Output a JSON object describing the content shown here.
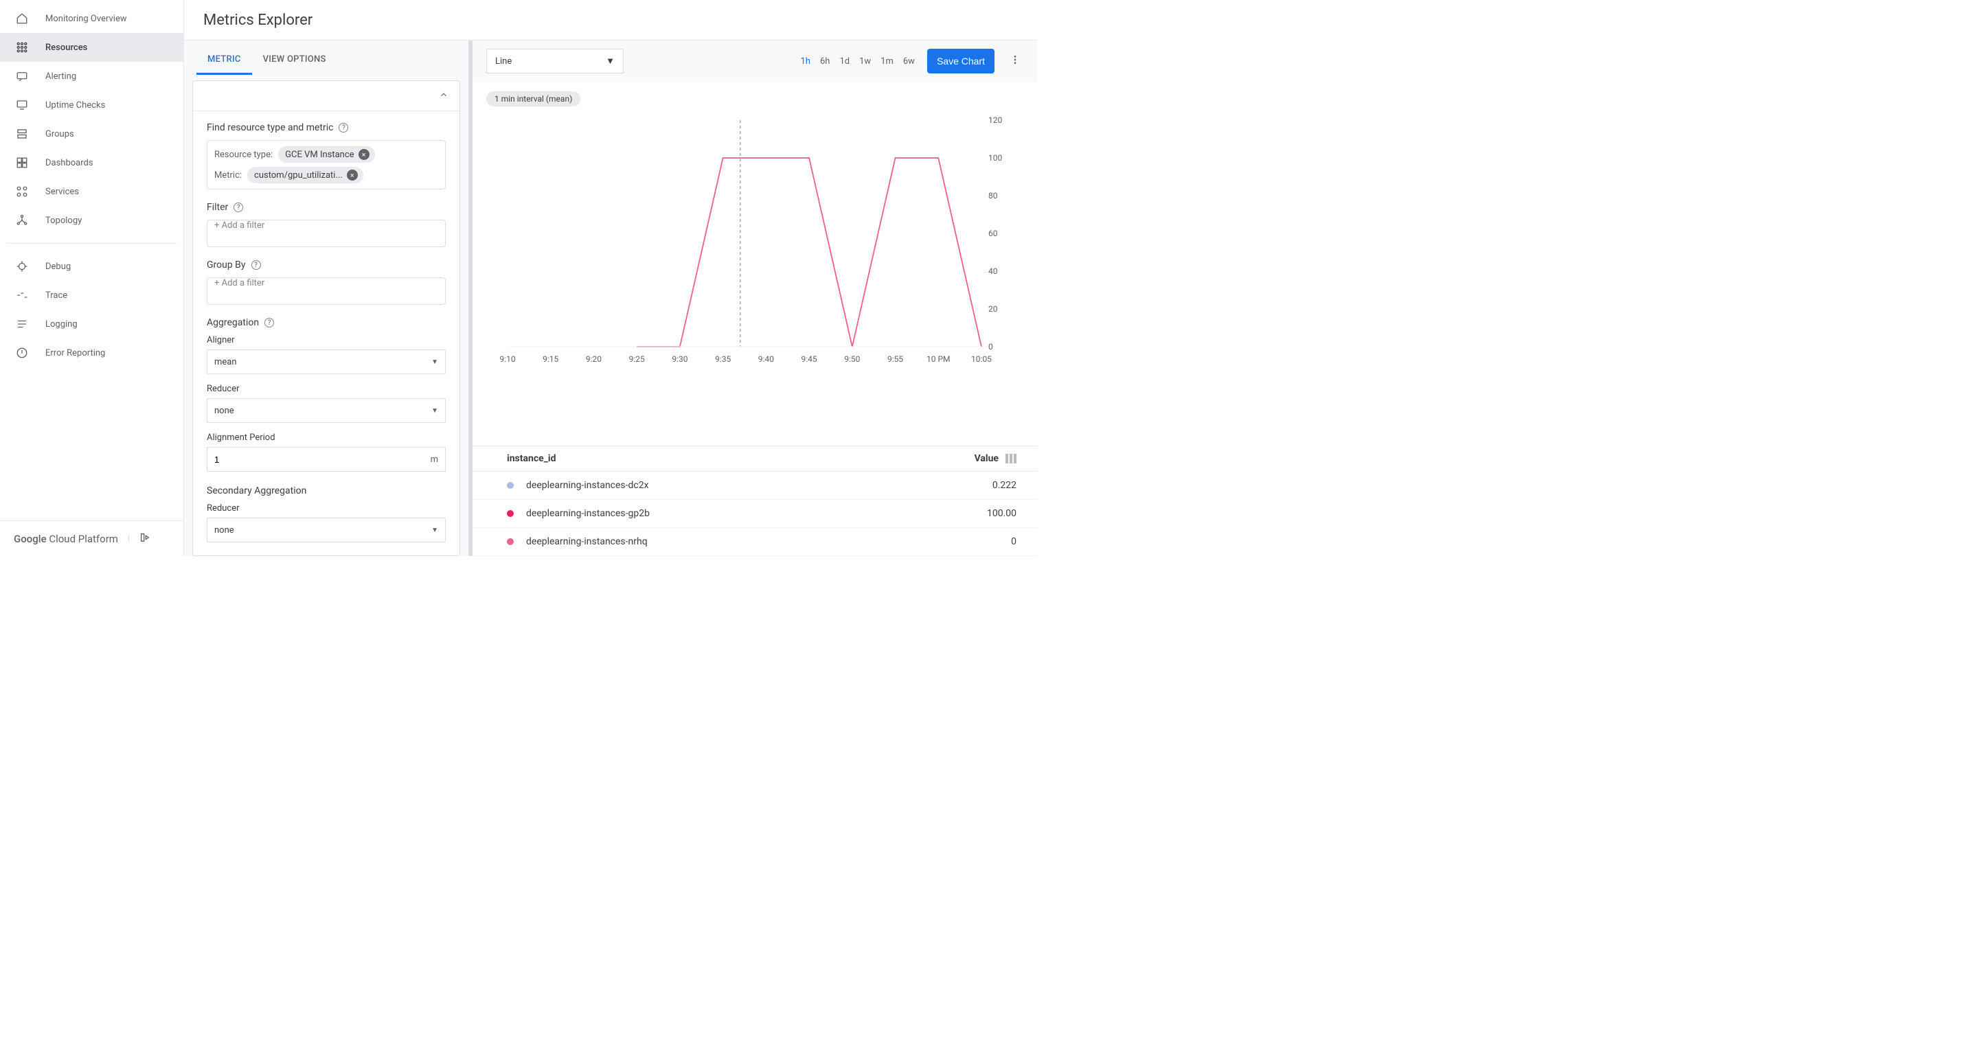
{
  "page_title": "Metrics Explorer",
  "sidebar": {
    "items": [
      {
        "label": "Monitoring Overview",
        "icon": "home",
        "active": false
      },
      {
        "label": "Resources",
        "icon": "grid",
        "active": true
      },
      {
        "label": "Alerting",
        "icon": "chat",
        "active": false
      },
      {
        "label": "Uptime Checks",
        "icon": "monitor",
        "active": false
      },
      {
        "label": "Groups",
        "icon": "stack",
        "active": false
      },
      {
        "label": "Dashboards",
        "icon": "dashboard",
        "active": false
      },
      {
        "label": "Services",
        "icon": "services",
        "active": false
      },
      {
        "label": "Topology",
        "icon": "topology",
        "active": false
      }
    ],
    "items_secondary": [
      {
        "label": "Debug",
        "icon": "debug"
      },
      {
        "label": "Trace",
        "icon": "trace"
      },
      {
        "label": "Logging",
        "icon": "logging"
      },
      {
        "label": "Error Reporting",
        "icon": "error"
      }
    ],
    "footer": "Google Cloud Platform"
  },
  "tabs": {
    "metric": "METRIC",
    "view_options": "VIEW OPTIONS"
  },
  "config": {
    "find_label": "Find resource type and metric",
    "resource_type_label": "Resource type:",
    "resource_type_value": "GCE VM Instance",
    "metric_label": "Metric:",
    "metric_value": "custom/gpu_utilizati...",
    "filter_label": "Filter",
    "filter_placeholder": "+ Add a filter",
    "groupby_label": "Group By",
    "groupby_placeholder": "+ Add a filter",
    "aggregation_label": "Aggregation",
    "aligner_label": "Aligner",
    "aligner_value": "mean",
    "reducer_label": "Reducer",
    "reducer_value": "none",
    "alignment_period_label": "Alignment Period",
    "alignment_period_value": "1",
    "alignment_period_unit": "m",
    "secondary_agg_label": "Secondary Aggregation",
    "secondary_reducer_label": "Reducer",
    "secondary_reducer_value": "none"
  },
  "chart_toolbar": {
    "chart_type": "Line",
    "ranges": [
      "1h",
      "6h",
      "1d",
      "1w",
      "1m",
      "6w"
    ],
    "active_range": "1h",
    "save_label": "Save Chart"
  },
  "interval_pill": "1 min interval (mean)",
  "chart_data": {
    "type": "line",
    "ylim": [
      0,
      100
    ],
    "yticks": [
      0,
      20,
      40,
      60,
      80,
      100,
      120
    ],
    "xticks": [
      "9:10",
      "9:15",
      "9:20",
      "9:25",
      "9:30",
      "9:35",
      "9:40",
      "9:45",
      "9:50",
      "9:55",
      "10 PM",
      "10:05"
    ],
    "cursor_x": "9:37",
    "series": [
      {
        "name": "deeplearning-instances-dc2x",
        "color": "#b0b9e8",
        "values": [
          null,
          null,
          null,
          null,
          null,
          null,
          null,
          null,
          null,
          0.2,
          null,
          null
        ]
      },
      {
        "name": "deeplearning-instances-gp2b",
        "color": "#e91e63",
        "values": [
          null,
          null,
          null,
          0,
          0,
          100,
          100,
          100,
          0,
          100,
          100,
          0
        ]
      },
      {
        "name": "deeplearning-instances-nrhq",
        "color": "#f06292",
        "values": [
          null,
          null,
          null,
          0,
          0,
          100,
          100,
          100,
          0,
          100,
          100,
          0
        ]
      }
    ]
  },
  "legend_table": {
    "col_instance": "instance_id",
    "col_value": "Value",
    "rows": [
      {
        "name": "deeplearning-instances-dc2x",
        "value": "0.222",
        "color": "#b0b9e8"
      },
      {
        "name": "deeplearning-instances-gp2b",
        "value": "100.00",
        "color": "#e91e63"
      },
      {
        "name": "deeplearning-instances-nrhq",
        "value": "0",
        "color": "#f06292"
      }
    ]
  }
}
